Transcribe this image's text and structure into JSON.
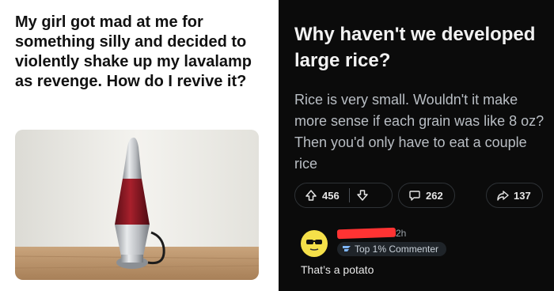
{
  "left": {
    "title": "My girl got mad at me for something silly and decided to violently shake up my lavalamp as revenge. How do I revive it?"
  },
  "right": {
    "title": "Why haven't we developed large rice?",
    "body": "Rice is very small. Wouldn't it make more sense if each grain was like 8 oz? Then you'd only have to eat a couple rice",
    "upvotes": "456",
    "comments": "262",
    "shares": "137",
    "comment": {
      "time": "2h",
      "badge": "Top 1% Commenter",
      "text": "That’s a potato"
    }
  },
  "colors": {
    "dark_bg": "#0b0b0b",
    "avatar": "#f5e049",
    "redaction": "#ff3333",
    "lamp_glow": "#b3202a"
  },
  "icons": [
    "upvote-icon",
    "downvote-icon",
    "comment-icon",
    "share-icon",
    "sunglasses-avatar-icon",
    "badge-icon"
  ]
}
